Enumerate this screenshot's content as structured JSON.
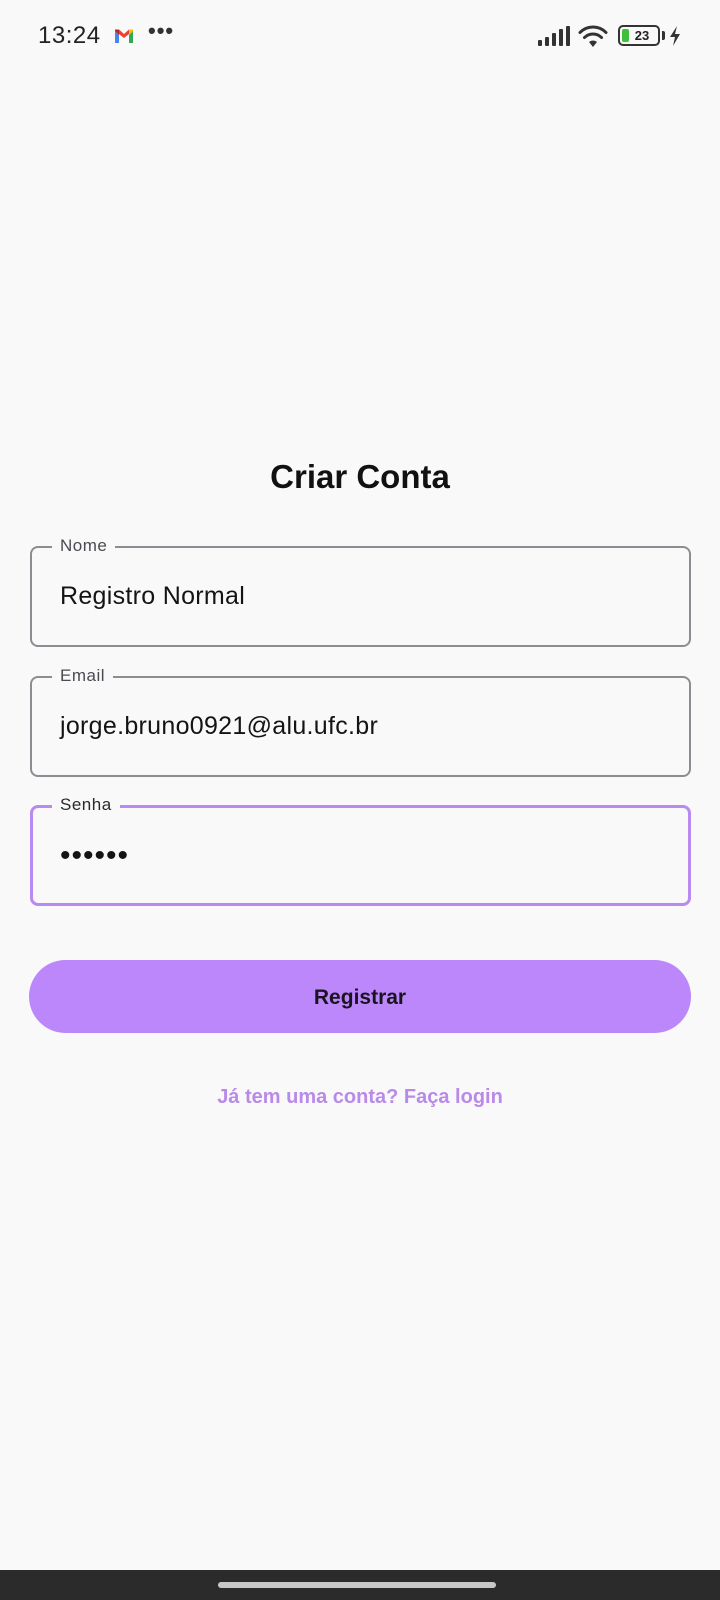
{
  "status_bar": {
    "time": "13:24",
    "more": "•••",
    "battery_level": "23",
    "icons": [
      "gmail-icon",
      "signal-icon",
      "wifi-icon",
      "battery-icon",
      "charging-icon"
    ]
  },
  "page": {
    "title": "Criar Conta"
  },
  "form": {
    "name": {
      "label": "Nome",
      "value": "Registro Normal"
    },
    "email": {
      "label": "Email",
      "value": "jorge.bruno0921@alu.ufc.br"
    },
    "password": {
      "label": "Senha",
      "value": "••••••"
    },
    "register_label": "Registrar",
    "login_link": "Já tem uma conta? Faça login"
  },
  "colors": {
    "accent": "#bb87fb",
    "focus_border": "#b98af0",
    "link": "#b98ae8",
    "background": "#f9f9fa",
    "battery_fill": "#3fbf3a"
  }
}
